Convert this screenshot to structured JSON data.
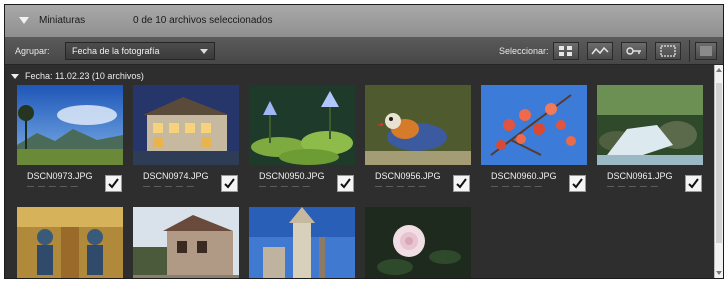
{
  "panel": {
    "title": "Miniaturas",
    "selection_count": "0 de 10 archivos seleccionados"
  },
  "toolbar": {
    "group_label": "Agrupar:",
    "group_value": "Fecha de la fotografía",
    "select_label": "Seleccionar:"
  },
  "group": {
    "header": "Fecha:  11.02.23 (10 archivos)"
  },
  "thumbnails": [
    {
      "filename": "DSCN0973.JPG",
      "checked": true
    },
    {
      "filename": "DSCN0974.JPG",
      "checked": true
    },
    {
      "filename": "DSCN0950.JPG",
      "checked": true
    },
    {
      "filename": "DSCN0956.JPG",
      "checked": true
    },
    {
      "filename": "DSCN0960.JPG",
      "checked": true
    },
    {
      "filename": "DSCN0961.JPG",
      "checked": true
    }
  ],
  "rating_placeholder": "— — — — —",
  "colors": {
    "panel_bg": "#2e2e2e",
    "title_strip": "#9c9c9c",
    "toolbar": "#4e4e4e",
    "text": "#f2f2f2"
  }
}
